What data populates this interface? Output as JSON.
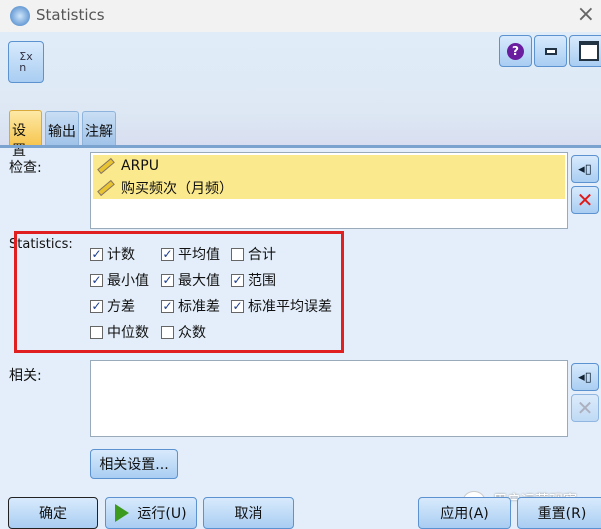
{
  "window": {
    "title": "Statistics",
    "close": "×"
  },
  "toolbar": {
    "node_icon": "sigma-x-over-n-icon",
    "help": "?"
  },
  "tabs": [
    {
      "label": "设置",
      "active": true
    },
    {
      "label": "输出",
      "active": false
    },
    {
      "label": "注解",
      "active": false
    }
  ],
  "examine": {
    "label": "检查:",
    "fields": [
      "ARPU",
      "购买频次（月频）"
    ]
  },
  "statistics": {
    "label": "Statistics:",
    "options": [
      {
        "label": "计数",
        "checked": true
      },
      {
        "label": "平均值",
        "checked": true
      },
      {
        "label": "合计",
        "checked": false
      },
      {
        "label": "最小值",
        "checked": true
      },
      {
        "label": "最大值",
        "checked": true
      },
      {
        "label": "范围",
        "checked": true
      },
      {
        "label": "方差",
        "checked": true
      },
      {
        "label": "标准差",
        "checked": true
      },
      {
        "label": "标准平均误差",
        "checked": true
      },
      {
        "label": "中位数",
        "checked": false
      },
      {
        "label": "众数",
        "checked": false
      }
    ]
  },
  "correlate": {
    "label": "相关:",
    "settings_button": "相关设置..."
  },
  "footer": {
    "ok": "确定",
    "run": "运行(U)",
    "cancel": "取消",
    "apply": "应用(A)",
    "reset": "重置(R)"
  },
  "watermark": "用户运营观察",
  "colors": {
    "highlight": "#fbe98d",
    "annotation_box": "#e02020"
  }
}
